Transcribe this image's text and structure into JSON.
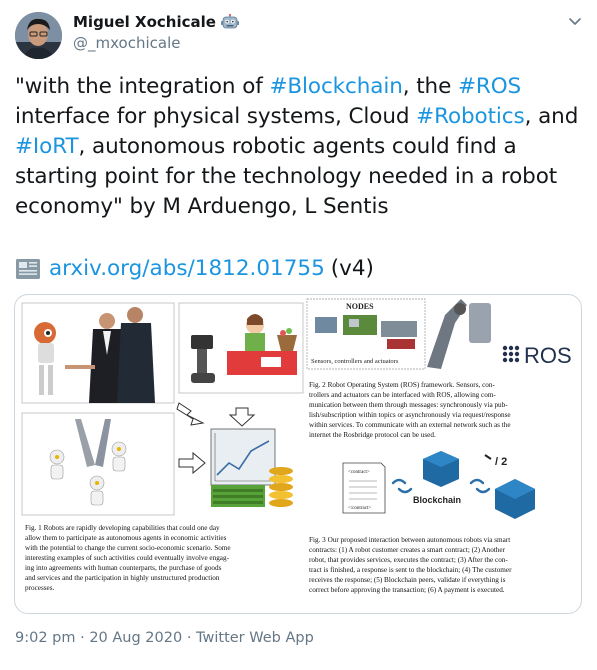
{
  "author": {
    "display_name": "Miguel Xochicale",
    "handle": "@_mxochicale",
    "badge_icon": "robot-face-icon"
  },
  "tweet": {
    "text_segments": [
      {
        "t": "\"with the integration of ",
        "tag": false
      },
      {
        "t": "#Blockchain",
        "tag": true
      },
      {
        "t": ", the ",
        "tag": false
      },
      {
        "t": "#ROS",
        "tag": true
      },
      {
        "t": " interface for physical systems, Cloud ",
        "tag": false
      },
      {
        "t": "#Robotics",
        "tag": true
      },
      {
        "t": ", and ",
        "tag": false
      },
      {
        "t": "#IoRT",
        "tag": true
      },
      {
        "t": ", autonomous robotic agents could find a starting point for the technology needed in a robot economy\"  by M Arduengo, L Sentis",
        "tag": false
      }
    ],
    "link_icon": "newspaper-icon",
    "link_text": "arxiv.org/abs/1812.01755",
    "link_suffix": "(v4)",
    "hashtag_color": "#1b95e0"
  },
  "media": {
    "nodes_label": "NODES",
    "sensors_label": "Sensors, controllers and actuators",
    "ros_label": "ROS",
    "fig2_caption": [
      "Fig. 2  Robot Operating System (ROS) framework. Sensors, con-",
      "trollers and actuators can be interfaced with ROS, allowing com-",
      "munication between them through messages: synchronously via pub-",
      "lish/subscription within topics or asynchronously via request/response",
      "within services. To communicate with an external network such as the",
      "internet the Rosbridge protocol can be used."
    ],
    "contract_label": "<contract>",
    "contract_close": "</contract>",
    "blockchain_label": "Blockchain",
    "fig1_caption": [
      "Fig. 1  Robots are rapidly developing capabilities that could one day",
      "allow them to participate as autonomous agents in economic activities",
      "with the potential to change the current socio-economic scenario. Some",
      "interesting examples of such activities could eventually involve engag-",
      "ing into agreements with human counterparts, the purchase of goods",
      "and services and the participation in highly unstructured production",
      "processes."
    ],
    "fig3_caption": [
      "Fig. 3  Our proposed interaction between autonomous robots via smart",
      "contracts: (1) A robot customer creates a smart contract; (2) Another",
      "robot, that provides services, executes the contract; (3) After the con-",
      "tract is finished, a response is sent to the blockchain; (4) The customer",
      "receives the response; (5) Blockchain peers, validate if everything is",
      "correct before approving the transaction; (6) A payment is executed."
    ]
  },
  "meta": {
    "time": "9:02 pm",
    "separator": " · ",
    "date": "20 Aug 2020",
    "client": "Twitter Web App"
  }
}
